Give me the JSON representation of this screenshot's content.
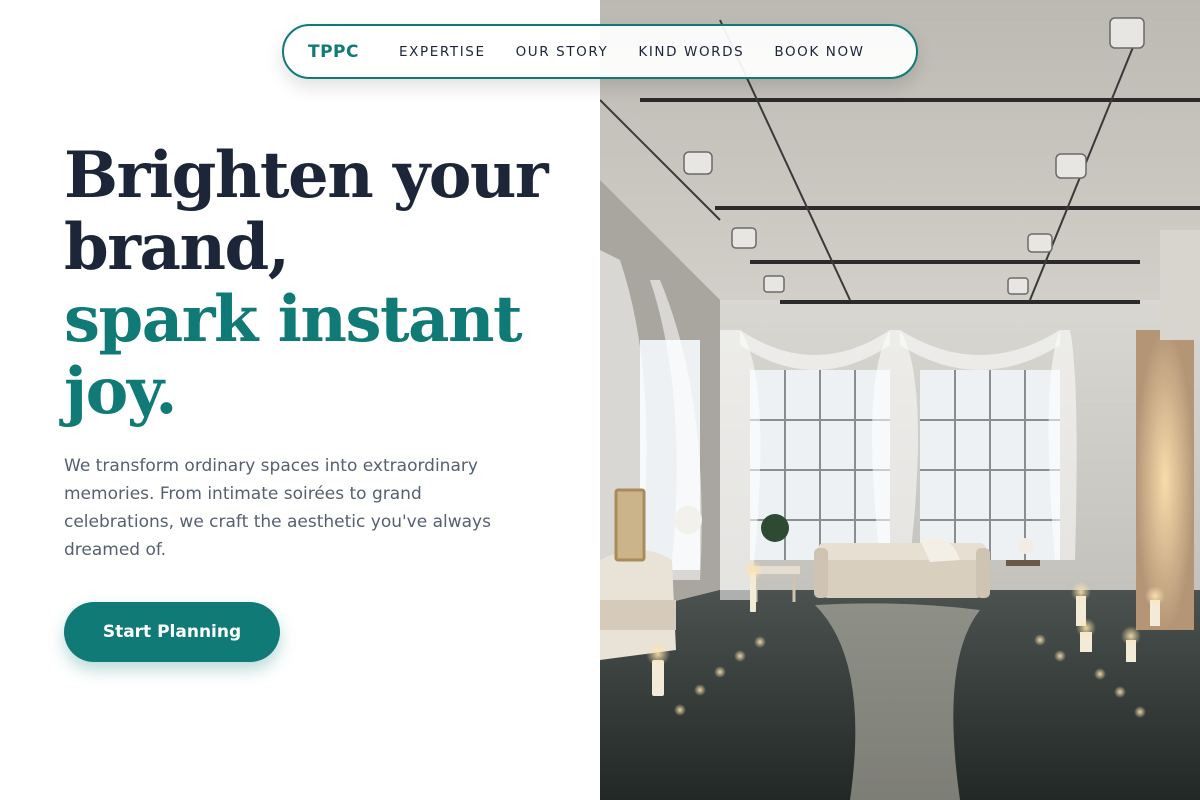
{
  "nav": {
    "brand": "TPPC",
    "links": [
      "EXPERTISE",
      "OUR STORY",
      "KIND WORDS",
      "BOOK NOW"
    ]
  },
  "hero": {
    "title_line1": "Brighten your",
    "title_line2": "brand,",
    "title_accent1": "spark instant",
    "title_accent2": "joy.",
    "description": "We transform ordinary spaces into extraordinary memories. From intimate soirées to grand celebrations, we craft the aesthetic you've always dreamed of.",
    "cta_label": "Start Planning"
  },
  "colors": {
    "accent": "#0f7a76",
    "heading": "#1c2638",
    "body_text": "#566070",
    "background": "#ffffff"
  },
  "image": {
    "alt": "Industrial loft venue decorated with sheer curtains, string lights, candles and a path of rose petals leading to a sofa"
  }
}
